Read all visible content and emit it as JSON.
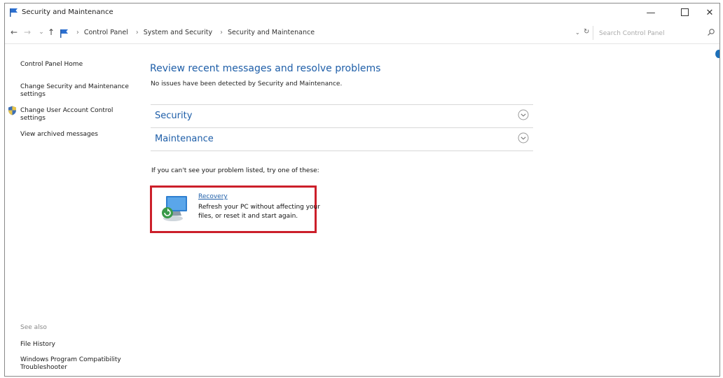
{
  "window": {
    "title": "Security and Maintenance"
  },
  "controls": {
    "minimize": "—",
    "close": "✕"
  },
  "address": {
    "breadcrumbs": [
      "Control Panel",
      "System and Security",
      "Security and Maintenance"
    ],
    "separator": "›",
    "search_placeholder": "Search Control Panel"
  },
  "sidebar": {
    "home": "Control Panel Home",
    "security_settings": "Change Security and Maintenance settings",
    "uac": "Change User Account Control settings",
    "archived": "View archived messages",
    "see_also": "See also",
    "file_history": "File History",
    "compat": "Windows Program Compatibility Troubleshooter"
  },
  "main": {
    "title": "Review recent messages and resolve problems",
    "subtitle": "No issues have been detected by Security and Maintenance.",
    "sections": [
      {
        "label": "Security",
        "expanded": false
      },
      {
        "label": "Maintenance",
        "expanded": false
      }
    ],
    "hint": "If you can't see your problem listed, try one of these:",
    "recovery": {
      "title": "Recovery",
      "description": "Refresh your PC without affecting your files, or reset it and start again."
    }
  },
  "colors": {
    "link": "#1e5ea8",
    "highlight": "#cc1f2a",
    "accent": "#1c6fb8"
  }
}
